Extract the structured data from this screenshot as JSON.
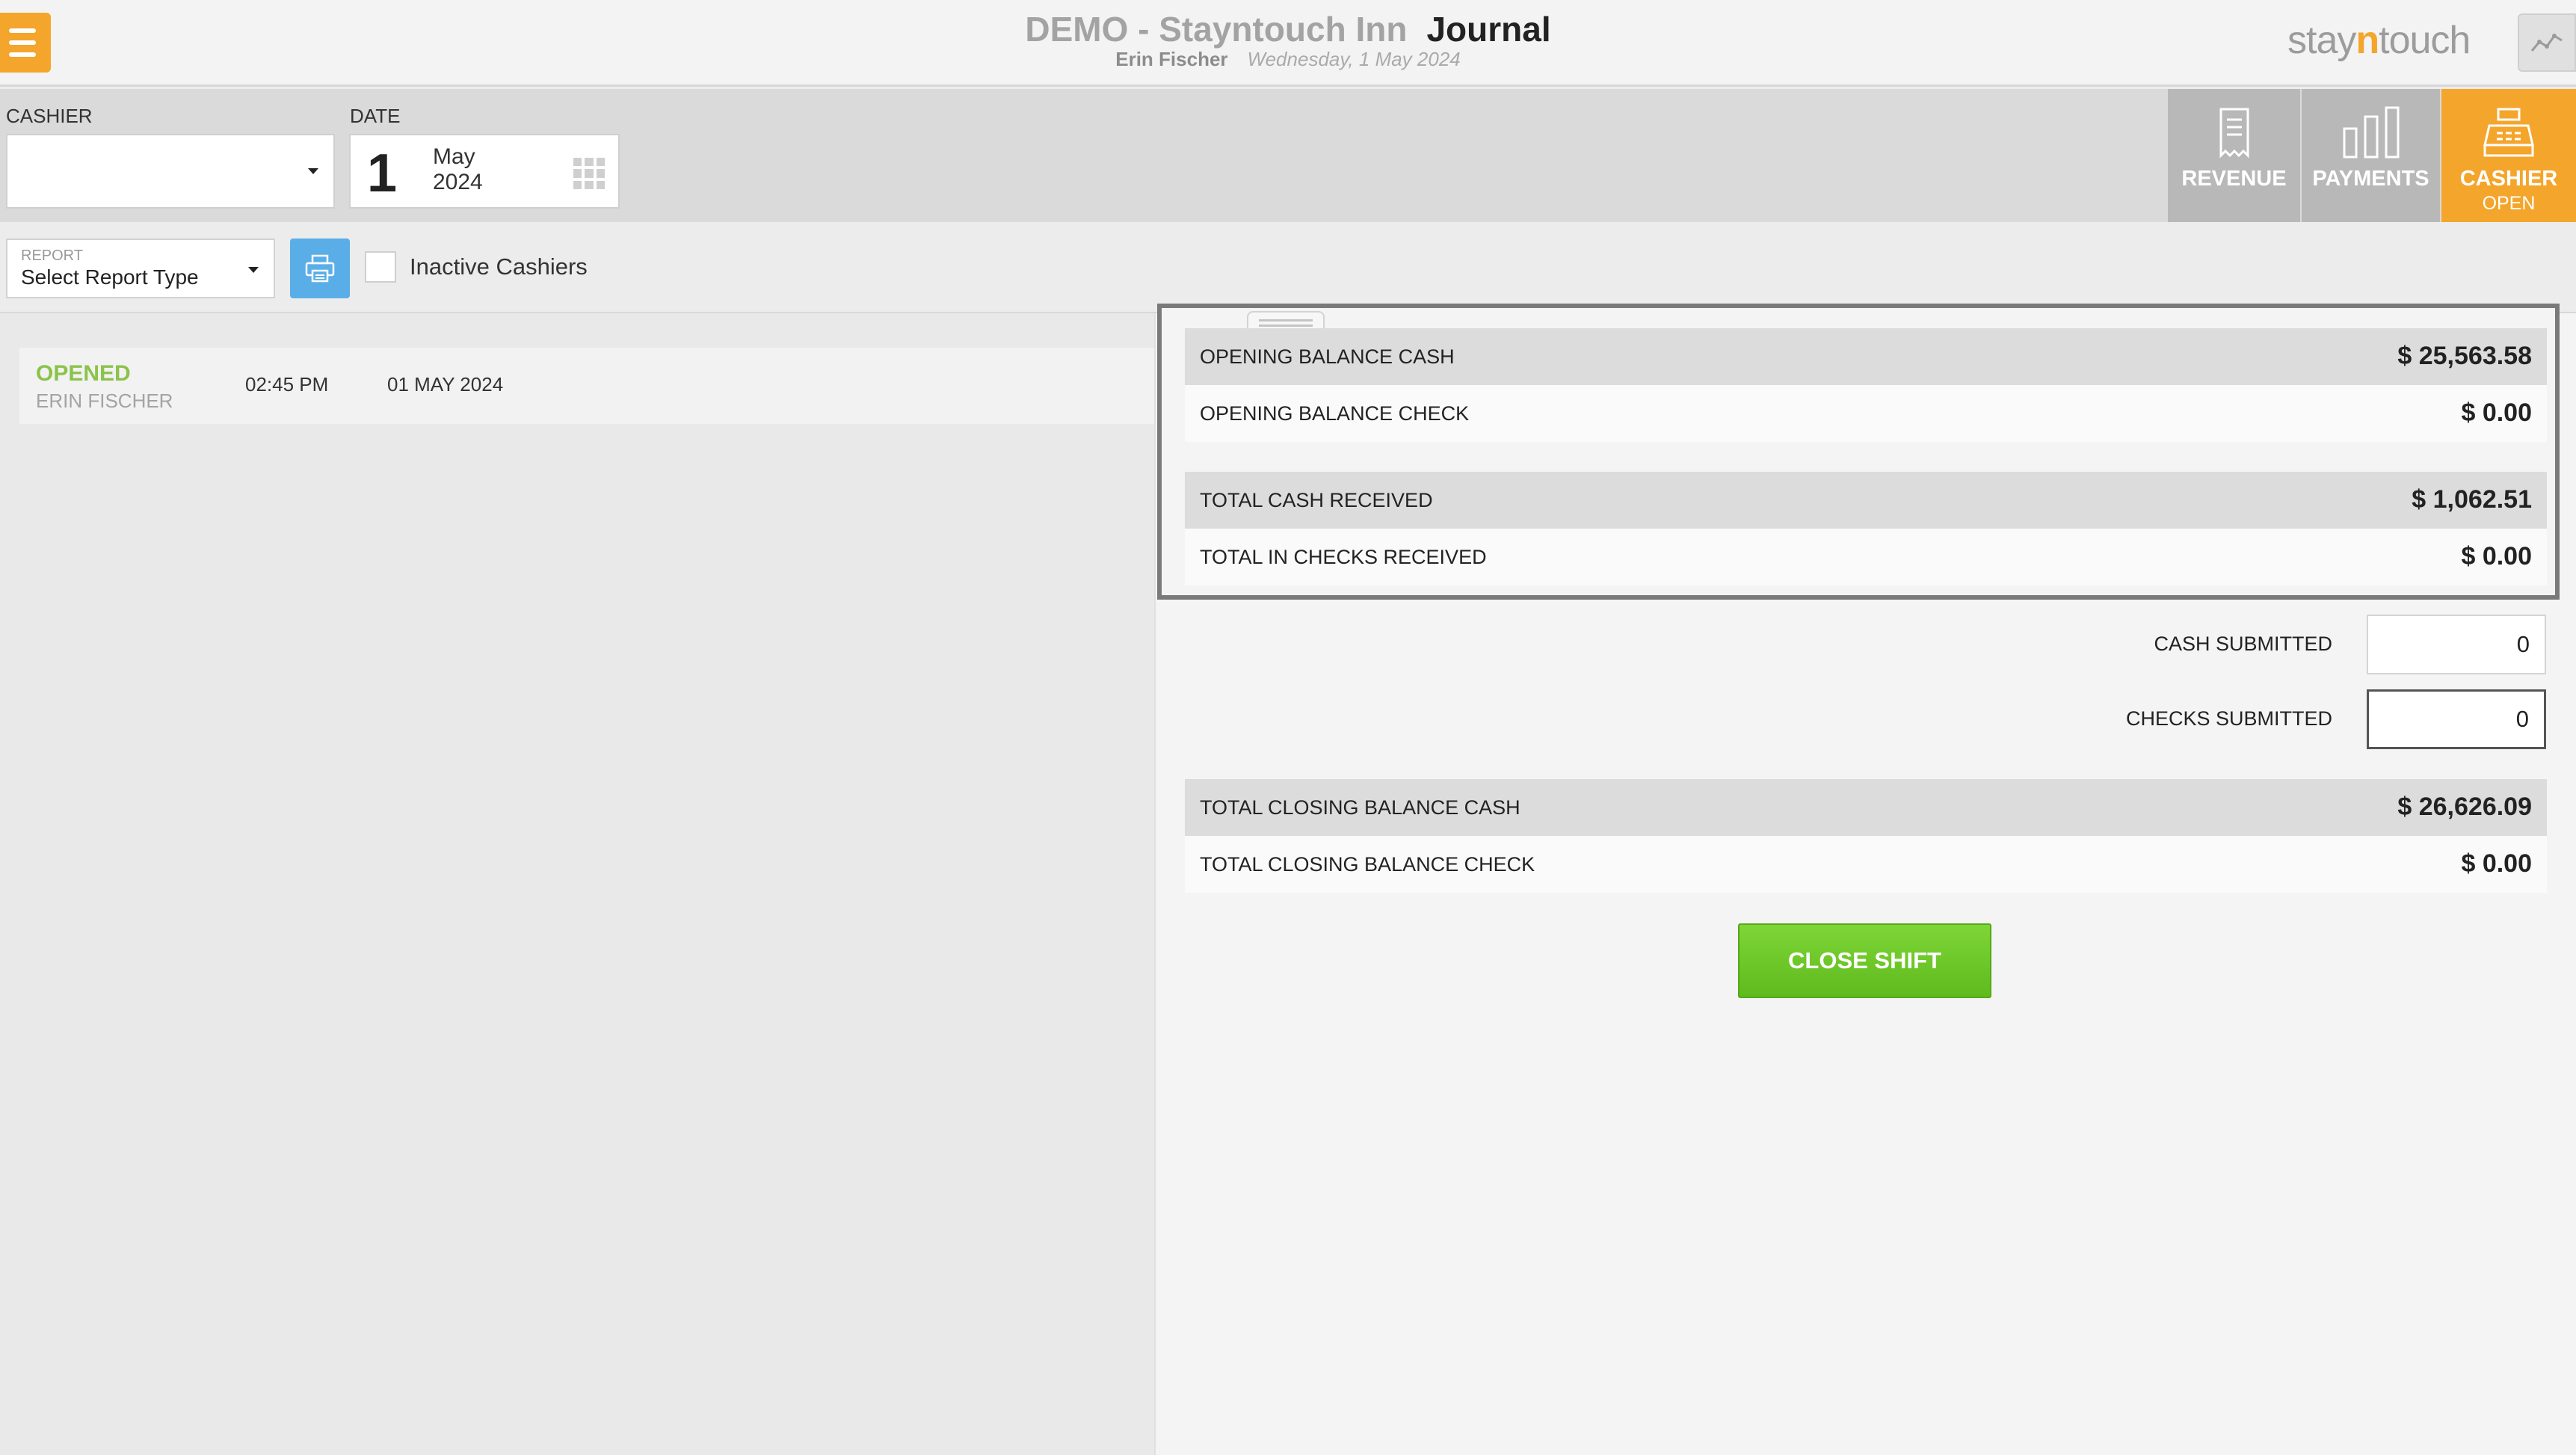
{
  "header": {
    "hotel_name": "DEMO - Stayntouch Inn",
    "page_title": "Journal",
    "user_name": "Erin Fischer",
    "current_date": "Wednesday, 1 May 2024",
    "brand_prefix": "stay",
    "brand_accent": "n",
    "brand_suffix": "touch",
    "accent_color": "#f4a52b"
  },
  "filters": {
    "cashier_label": "CASHIER",
    "cashier_value": "",
    "date_label": "DATE",
    "date_day": "1",
    "date_month": "May",
    "date_year": "2024"
  },
  "tabs": [
    {
      "label": "REVENUE",
      "sub": "",
      "icon": "receipt-icon"
    },
    {
      "label": "PAYMENTS",
      "sub": "",
      "icon": "bar-chart-icon"
    },
    {
      "label": "CASHIER",
      "sub": "OPEN",
      "icon": "cash-register-icon",
      "active": true
    }
  ],
  "report": {
    "small_label": "REPORT",
    "value": "Select Report Type",
    "inactive_label": "Inactive Cashiers",
    "inactive_checked": false
  },
  "shifts": [
    {
      "status": "OPENED",
      "name": "ERIN FISCHER",
      "time": "02:45 PM",
      "date": "01 MAY 2024"
    }
  ],
  "balances": {
    "opening_cash_label": "OPENING BALANCE CASH",
    "opening_cash_value": "$ 25,563.58",
    "opening_check_label": "OPENING BALANCE CHECK",
    "opening_check_value": "$ 0.00",
    "total_cash_label": "TOTAL CASH RECEIVED",
    "total_cash_value": "$ 1,062.51",
    "total_checks_label": "TOTAL IN CHECKS RECEIVED",
    "total_checks_value": "$ 0.00"
  },
  "submitted": {
    "cash_label": "CASH SUBMITTED",
    "cash_value": "0",
    "checks_label": "CHECKS SUBMITTED",
    "checks_value": "0"
  },
  "closing": {
    "cash_label": "TOTAL CLOSING BALANCE CASH",
    "cash_value": "$ 26,626.09",
    "check_label": "TOTAL CLOSING BALANCE CHECK",
    "check_value": "$ 0.00"
  },
  "actions": {
    "close_shift_label": "CLOSE SHIFT"
  }
}
